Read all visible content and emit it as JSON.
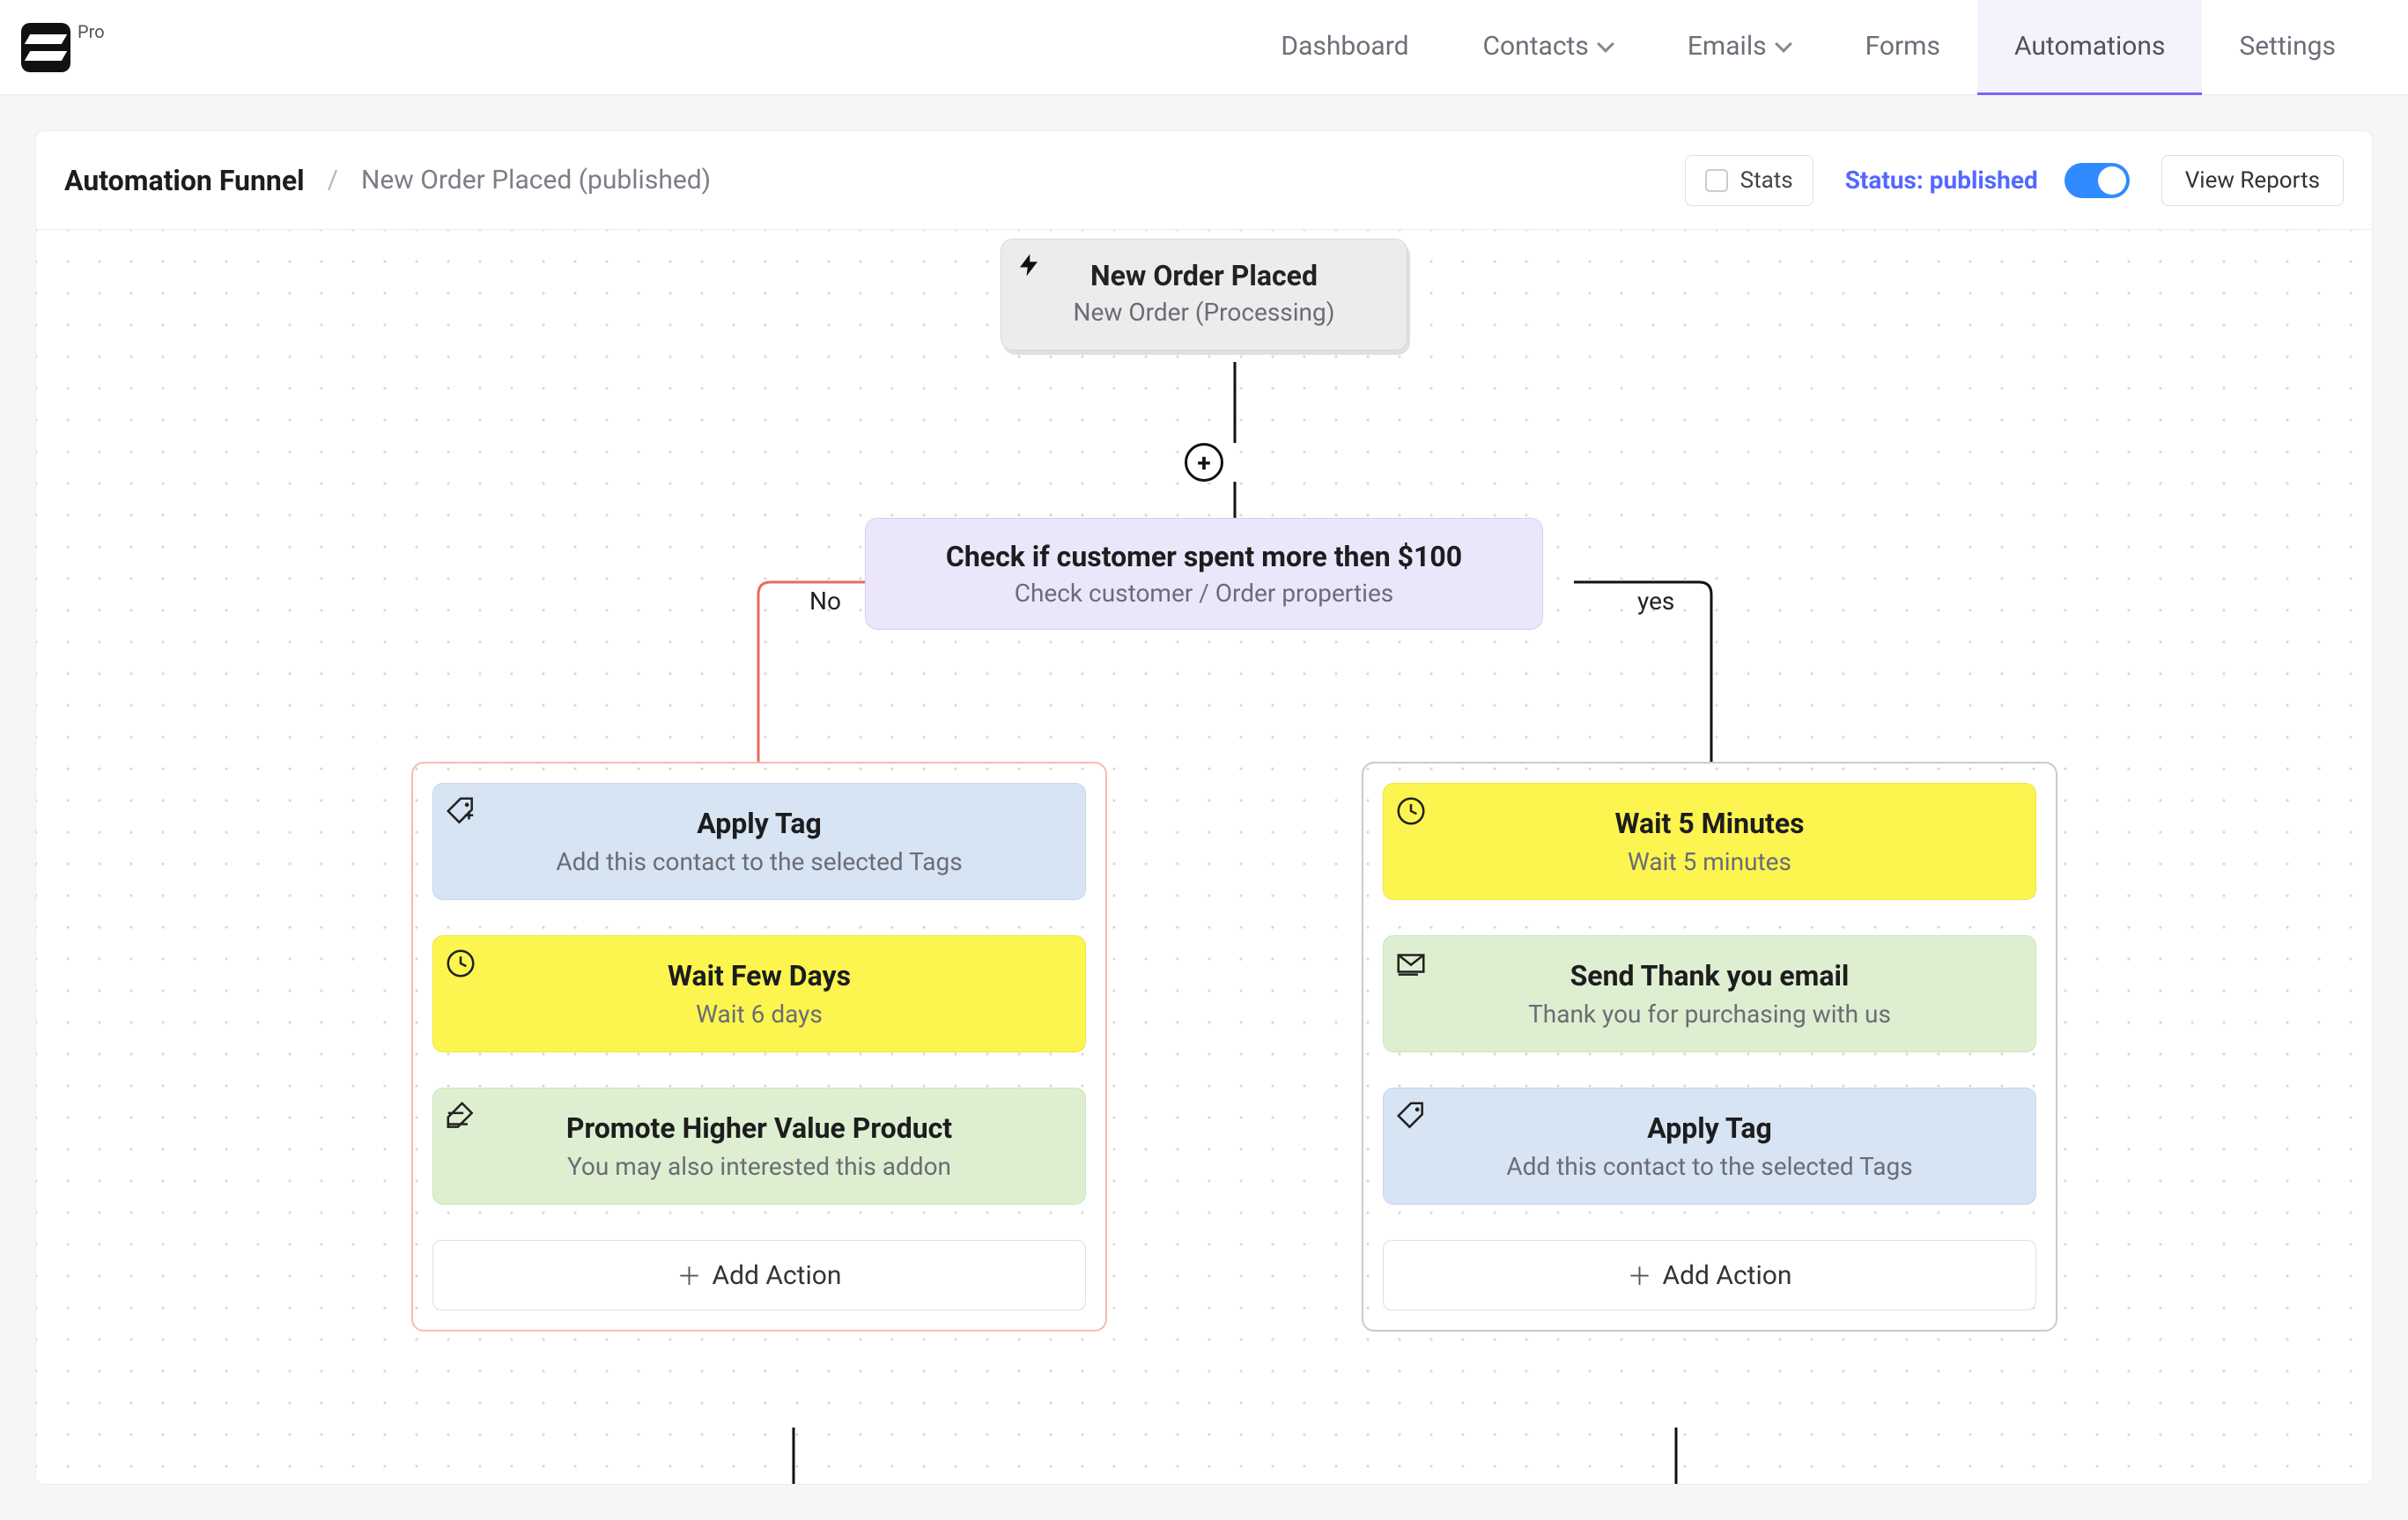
{
  "logo_badge": "Pro",
  "nav": {
    "dashboard": "Dashboard",
    "contacts": "Contacts",
    "emails": "Emails",
    "forms": "Forms",
    "automations": "Automations",
    "settings": "Settings"
  },
  "breadcrumb": {
    "main": "Automation Funnel",
    "sub": "New Order Placed (published)"
  },
  "header": {
    "stats": "Stats",
    "status_label": "Status: published",
    "view_reports": "View Reports"
  },
  "trigger": {
    "title": "New Order Placed",
    "subtitle": "New Order (Processing)"
  },
  "condition": {
    "title": "Check if customer spent more then $100",
    "subtitle": "Check customer / Order properties"
  },
  "branch_labels": {
    "no": "No",
    "yes": "yes"
  },
  "left_branch": {
    "cards": [
      {
        "title": "Apply Tag",
        "subtitle": "Add this contact to the selected Tags",
        "color": "c-blue",
        "icon": "tag-plus-icon"
      },
      {
        "title": "Wait Few Days",
        "subtitle": "Wait 6 days",
        "color": "c-yellow",
        "icon": "clock-icon"
      },
      {
        "title": "Promote Higher Value Product",
        "subtitle": "You may also interested this addon",
        "color": "c-green",
        "icon": "compose-icon"
      }
    ],
    "add_action": "Add Action"
  },
  "right_branch": {
    "cards": [
      {
        "title": "Wait 5 Minutes",
        "subtitle": "Wait 5 minutes",
        "color": "c-yellow",
        "icon": "clock-icon"
      },
      {
        "title": "Send Thank you email",
        "subtitle": "Thank you for purchasing with us",
        "color": "c-green",
        "icon": "compose-icon"
      },
      {
        "title": "Apply Tag",
        "subtitle": "Add this contact to the selected Tags",
        "color": "c-blue",
        "icon": "tag-plus-icon"
      }
    ],
    "add_action": "Add Action"
  }
}
